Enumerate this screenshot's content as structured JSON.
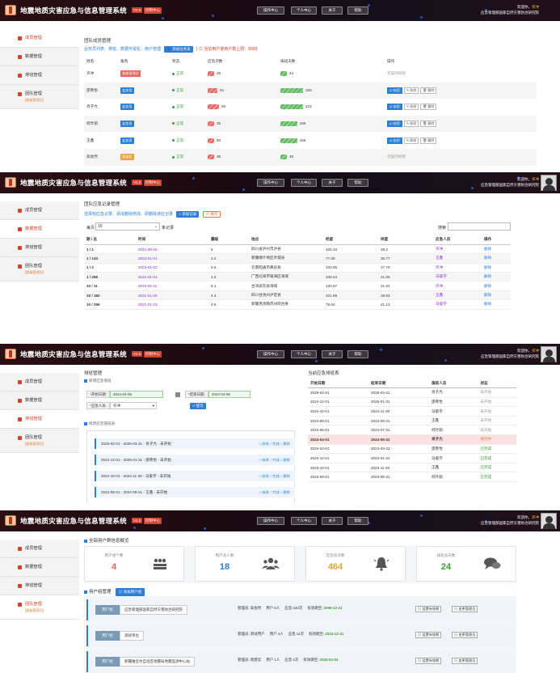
{
  "app": {
    "title": "地震地质灾害应急与信息管理系统",
    "version": "V2.0",
    "control_center": "控制中心",
    "nav": [
      "操作中心",
      "个人中心",
      "关于",
      "帮助"
    ],
    "welcome": "欢迎你，",
    "user": "许冲",
    "org": "应急管理部国家自然灾害防治研究院",
    "accent": "#d0432e",
    "topbar_color": "#1a0a10"
  },
  "sidebar": {
    "items": [
      {
        "label": "成员管理",
        "icon": "user-icon"
      },
      {
        "label": "数据管理",
        "icon": "database-icon"
      },
      {
        "label": "排班管理",
        "icon": "calendar-icon"
      },
      {
        "label": "团队管理",
        "sub": "[超级管理员]",
        "icon": "team-icon"
      }
    ]
  },
  "panel1": {
    "heading": "团队成员管理",
    "links": "业务员列表、排班、数据可视化、用户管理",
    "add_btn": "添加业务员",
    "limit_note": "当前用户使用户数上限：",
    "limit_value": "8999",
    "columns": [
      "姓名",
      "角色",
      "状态",
      "应急次数",
      "排班天数",
      "操作"
    ],
    "rows": [
      {
        "name": "许冲",
        "role": "超级管理员",
        "role_color": "#e8635a",
        "status": "正常",
        "emergency": 26,
        "duty": 44,
        "ops": "无操作权限"
      },
      {
        "name": "邵青怡",
        "role": "业务员",
        "role_color": "#2d7fd6",
        "status": "正常",
        "emergency": 81,
        "duty": 225,
        "ops": ""
      },
      {
        "name": "肖子亢",
        "role": "业务员",
        "role_color": "#2d7fd6",
        "status": "正常",
        "emergency": 93,
        "duty": 223,
        "ops": ""
      },
      {
        "name": "何叶丽",
        "role": "业务员",
        "role_color": "#2d7fd6",
        "status": "正常",
        "emergency": 35,
        "duty": 166,
        "ops": ""
      },
      {
        "name": "王鑫",
        "role": "业务员",
        "role_color": "#2d7fd6",
        "status": "正常",
        "emergency": 50,
        "duty": 166,
        "ops": ""
      },
      {
        "name": "高会然",
        "role": "管理员",
        "role_color": "#e8a33a",
        "status": "正常",
        "emergency": 38,
        "duty": 45,
        "ops": "无操作权限"
      }
    ],
    "op_labels": [
      "启用",
      "修改",
      "删除"
    ]
  },
  "panel2": {
    "heading": "团队应急记录管理",
    "links": "选择权应急记录、添加删除修改、即删除该应记录",
    "add_btn": "添加记录",
    "del_btn": "删除",
    "page_label": "每页",
    "page_size": "10",
    "page_suffix": "条记录",
    "search_label": "搜索",
    "columns": [
      "期 / 总",
      "时间",
      "震级",
      "地点",
      "经度",
      "纬度",
      "应急人员",
      "操作"
    ],
    "rows": [
      [
        "1 / 1",
        "2021-09-16",
        "6",
        "四川省泸州市泸县",
        "105.34",
        "29.2",
        "许冲",
        "删除"
      ],
      [
        "1 / 143",
        "2023-01-01",
        "4.2",
        "新疆喀什地区叶城县",
        "77.08",
        "36.77",
        "王鑫",
        "删除"
      ],
      [
        "1 / 2",
        "2022-01-02",
        "5.5",
        "云南昭通市彝良县",
        "100.65",
        "27.79",
        "许冲",
        "删除"
      ],
      [
        "1 / 266",
        "2021-01-04",
        "4.2",
        "广西北海市银海区海域",
        "109.24",
        "21.05",
        "马俊学",
        "删除"
      ],
      [
        "10 / 11",
        "2022-04-11",
        "5.1",
        "台湾屏东县海域",
        "120.57",
        "21.62",
        "许冲",
        "删除"
      ],
      [
        "10 / 182",
        "2021-01-26",
        "4.4",
        "四川甘孜州泸定县",
        "101.99",
        "29.63",
        "王鑫",
        "删除"
      ],
      [
        "10 / 296",
        "2021-01-23",
        "4.6",
        "新疆克孜勒苏州阿合奇",
        "78.64",
        "41.13",
        "马俊学",
        "删除"
      ]
    ]
  },
  "panel3": {
    "heading": "排班管理",
    "new_label": "新增应急值班",
    "start_label": "开始日期:",
    "start_value": "2024-04-06",
    "end_label": "结束日期:",
    "end_value": "2024-04-06",
    "person_label": "应急人员:",
    "person_value": "许冲",
    "submit": "提交",
    "list_label": "修改应急值班表",
    "shifts": [
      "2025-02-01 - 2025-03-31 - 肖子亢 - 未开始",
      "2024-12-01 - 2025-01-31 - 邵青怡 - 未开始",
      "2024-10-01 - 2024-11-30 - 马俊学 - 未开始",
      "2024-08-01 - 2024-09-31 - 王鑫 - 未开始"
    ],
    "shift_ops": "□ 修改   □ 完成   □ 删除",
    "table_title": "当前应急排班表",
    "table_cols": [
      "开始日期",
      "结束日期",
      "值班人员",
      "状态"
    ],
    "table_rows": [
      [
        "2025-02-01",
        "2025-03-31",
        "肖子亢",
        "未开始",
        "grey"
      ],
      [
        "2024-12-01",
        "2025-01-31",
        "邵青怡",
        "未开始",
        "grey"
      ],
      [
        "2024-10-01",
        "2024-11-30",
        "马俊学",
        "未开始",
        "grey"
      ],
      [
        "2024-08-01",
        "2024-09-31",
        "王鑫",
        "未开始",
        "grey"
      ],
      [
        "2024-06-01",
        "2024-07-31",
        "何叶丽",
        "未开始",
        "grey"
      ],
      [
        "2024-04-01",
        "2024-05-31",
        "肖子亢",
        "进行中",
        "orng"
      ],
      [
        "2024-02-01",
        "2024-03-31",
        "邵青怡",
        "已完成",
        "grn"
      ],
      [
        "2023-12-01",
        "2024-01-31",
        "马俊学",
        "已完成",
        "grn"
      ],
      [
        "2023-10-01",
        "2023-11-30",
        "王鑫",
        "已完成",
        "grn"
      ],
      [
        "2023-08-01",
        "2023-09-31",
        "何叶丽",
        "已完成",
        "grn"
      ]
    ]
  },
  "panel4": {
    "heading": "全部用户群信息概览",
    "stats": [
      {
        "label": "用户组个数",
        "value": "4",
        "color": "#e8635a",
        "icon": "group-icon"
      },
      {
        "label": "用户总人数",
        "value": "18",
        "color": "#2d7fd6",
        "icon": "users-icon"
      },
      {
        "label": "应急总次数",
        "value": "464",
        "color": "#e8a33a",
        "icon": "bell-icon"
      },
      {
        "label": "排班总天数",
        "value": "24",
        "color": "#3a9d3a",
        "icon": "chat-icon"
      }
    ],
    "group_heading": "用户组管理",
    "add_group_btn": "添加用户组",
    "groups": [
      {
        "tag": "用户组",
        "name": "应急管理部国家自然灾害防治研究院",
        "admin": "高会然",
        "users": "8人",
        "emergency": "420次",
        "expiry": "2099-12-31"
      },
      {
        "tag": "用户组",
        "name": "测试单位",
        "admin": "测试用户",
        "users": "4人",
        "emergency": "11次",
        "expiry": "2024-12-31"
      },
      {
        "tag": "用户组",
        "name": "新疆维吾尔自治区地震局地震监测中心站",
        "admin": "周建云",
        "users": "1人",
        "emergency": "4次",
        "expiry": "2025-02-04"
      }
    ],
    "labels": {
      "admin": "管理员:",
      "users": "用户",
      "emergency": "应急",
      "expiry": "有效期至:",
      "set_btn": "设置有效期",
      "change_btn": "变更管理员"
    }
  }
}
